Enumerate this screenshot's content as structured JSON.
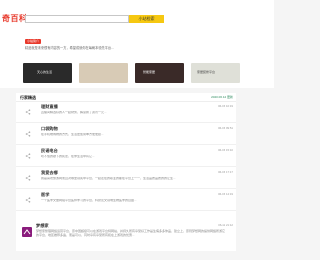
{
  "header": {
    "logo": "奇百科",
    "search_placeholder": "",
    "search_button": "小站检索"
  },
  "intro": {
    "tag": "小站简介",
    "text": "精品就是未来很有内容的一方，希望成就你在每刷本领先平台..."
  },
  "banners": [
    {
      "label": "天心的生活",
      "bg": "#2a2a2a",
      "fg": "#eee"
    },
    {
      "label": "",
      "bg": "#d8cbb6",
      "fg": "#444"
    },
    {
      "label": "智能家居",
      "bg": "#3a2a28",
      "fg": "#fff"
    },
    {
      "label": "家居装修平台",
      "bg": "#dfe0d8",
      "fg": "#444"
    }
  ],
  "panel": {
    "title": "行家精选",
    "date": "2020.06.12 更新"
  },
  "items": [
    {
      "title": "理财直播",
      "desc": "直播间精选好的人一起财务，解读换了资讯一元...",
      "time": "06-15 10:19"
    },
    {
      "title": "口袋购物",
      "desc": "在手机端购物的方式，生活更加简单方便便捷...",
      "time": "06-15 09:51"
    },
    {
      "title": "民谣电台",
      "desc": "听不懂的歌下的民谣，在你生活中有它...",
      "time": "06-15 15:10"
    },
    {
      "title": "我爱去哪",
      "desc": "我是喜欢旅游网而且对哪里领先中平台，一起走往的职业的都在平台上一一，生活品质品质的的让生...",
      "time": "06-15 17:17"
    },
    {
      "title": "医学",
      "desc": "一个医学文章网站平台医师学习的平台，科研论文领域生物医学的自由...",
      "time": "06-15 14:19"
    }
  ],
  "last": {
    "title": "梦想家",
    "desc": "梦想家整理网络运营平台，原中国超级可以在游戏平台特网站，并持久所有享受好工作是生病多多你品，建立上，原则梦想网的提供网络所游它的平台，地区推荐多遍，而是可以，同时享有享受所有和在上游戏的优惠...",
    "time": "06-11 21:12"
  }
}
